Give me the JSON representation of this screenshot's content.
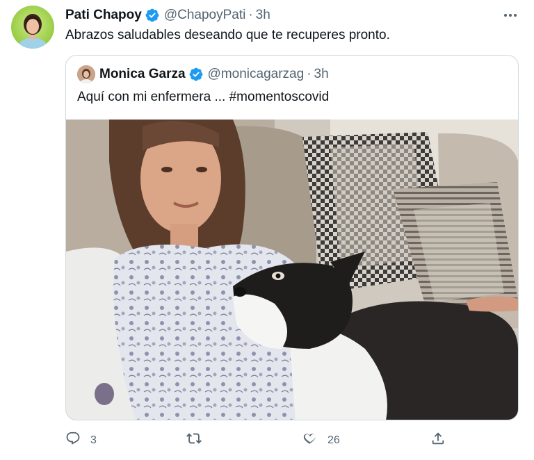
{
  "tweet": {
    "author_name": "Pati Chapoy",
    "author_handle": "@ChapoyPati",
    "separator": "·",
    "time": "3h",
    "text": "Abrazos saludables deseando que te recuperes pronto."
  },
  "quoted": {
    "author_name": "Monica Garza",
    "author_handle": "@monicagarzag",
    "separator": "·",
    "time": "3h",
    "text": "Aquí con mi enfermera ... #momentoscovid"
  },
  "actions": {
    "reply_count": "3",
    "retweet_count": "",
    "like_count": "26"
  },
  "colors": {
    "verified": "#1d9bf0",
    "secondary_text": "#536471",
    "border": "#cfd9de"
  },
  "icons": [
    "more-icon",
    "verified-icon",
    "reply-icon",
    "retweet-icon",
    "like-icon",
    "share-icon"
  ]
}
